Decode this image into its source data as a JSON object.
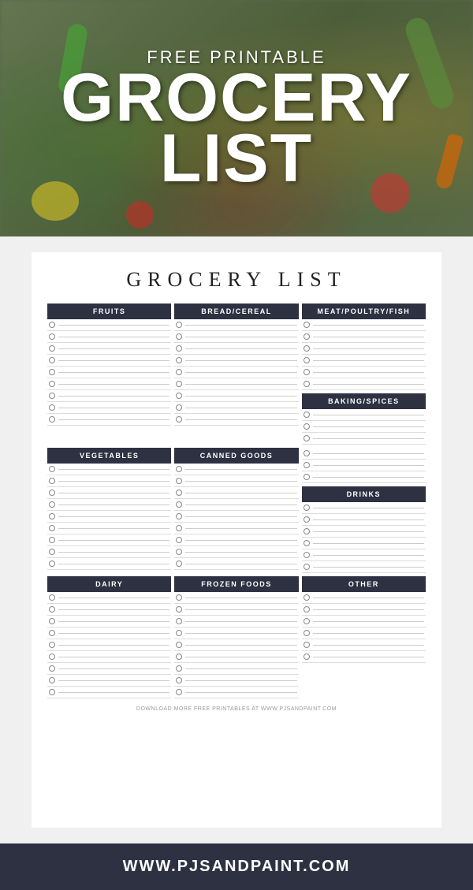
{
  "hero": {
    "subtitle": "FREE PRINTABLE",
    "title_line1": "GROCERY",
    "title_line2": "LIST"
  },
  "card": {
    "title": "GROCERY LIST",
    "categories": {
      "fruits": {
        "label": "FRUITS",
        "lines": 9
      },
      "bread_cereal": {
        "label": "BREAD/CEREAL",
        "lines": 9
      },
      "meat": {
        "label": "MEAT/POULTRY/FISH",
        "lines": 6
      },
      "vegetables": {
        "label": "VEGETABLES",
        "lines": 9
      },
      "canned_goods": {
        "label": "CANNED GOODS",
        "lines": 9
      },
      "baking_spices": {
        "label": "BAKING/SPICES",
        "lines": 6
      },
      "dairy": {
        "label": "DAIRY",
        "lines": 9
      },
      "frozen_foods": {
        "label": "FROZEN FOODS",
        "lines": 9
      },
      "drinks": {
        "label": "DRINKS",
        "lines": 6
      },
      "other": {
        "label": "OTHER",
        "lines": 6
      }
    },
    "footer": "DOWNLOAD MORE FREE PRINTABLES AT WWW.PJSANDPAINT.COM"
  },
  "bottom_bar": {
    "url": "WWW.PJSANDPAINT.COM"
  }
}
